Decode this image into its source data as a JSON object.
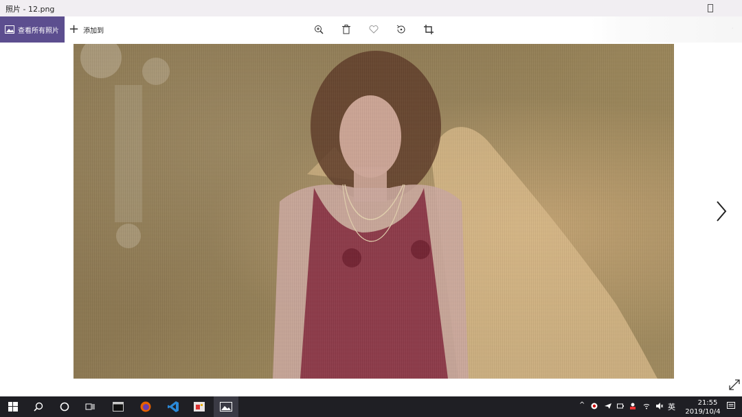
{
  "window": {
    "title": "照片 - 12.png"
  },
  "command_bar": {
    "all_photos_label": "查看所有照片",
    "add_to_label": "添加到",
    "tools": [
      "zoom-icon",
      "delete-icon",
      "favorite-icon",
      "rotate-icon",
      "crop-icon"
    ]
  },
  "viewer": {
    "next_icon": "chevron-right-icon",
    "expand_icon": "expand-icon"
  },
  "taskbar": {
    "pinned": [
      "start-icon",
      "search-icon",
      "cortana-icon",
      "task-view-icon",
      "terminal-icon",
      "firefox-icon",
      "vscode-icon",
      "app-icon",
      "photos-icon"
    ],
    "tray": {
      "lang": "英",
      "time": "21:55",
      "date": "2019/10/4"
    }
  },
  "colors": {
    "accent": "#5c4e8f",
    "taskbar": "#1f1f24"
  }
}
